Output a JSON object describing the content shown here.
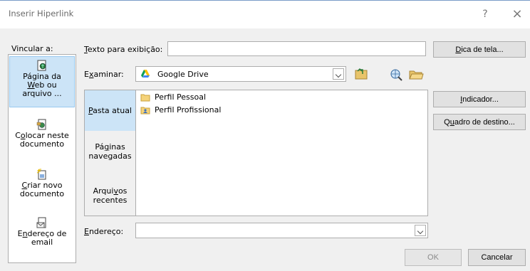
{
  "dialog": {
    "title": "Inserir Hiperlink",
    "help_label": "?",
    "close_label": "×"
  },
  "link_to": {
    "label": "Vincular a:",
    "items": [
      {
        "label": "Página da Web ou arquivo ...",
        "selected": true,
        "icon": "web-page-icon"
      },
      {
        "label": "Colocar neste documento",
        "selected": false,
        "icon": "place-in-document-icon"
      },
      {
        "label": "Criar novo documento",
        "selected": false,
        "icon": "new-document-icon"
      },
      {
        "label": "Endereço de email",
        "selected": false,
        "icon": "email-icon"
      }
    ]
  },
  "display_text": {
    "label": "Texto para exibição:",
    "value": ""
  },
  "look_in": {
    "label": "Examinar:",
    "value": "Google Drive",
    "icon": "google-drive-icon"
  },
  "browse_tabs": [
    {
      "label": "Pasta atual",
      "selected": true
    },
    {
      "label": "Páginas navegadas",
      "selected": false
    },
    {
      "label": "Arquivos recentes",
      "selected": false
    }
  ],
  "files": [
    {
      "name": "Perfil Pessoal",
      "icon": "folder-icon"
    },
    {
      "name": "Perfil Profissional",
      "icon": "shared-folder-icon"
    }
  ],
  "address": {
    "label": "Endereço:",
    "value": ""
  },
  "side_buttons": {
    "screentip": "Dica de tela...",
    "bookmark": "Indicador...",
    "target_frame": "Quadro de destino..."
  },
  "footer": {
    "ok": "OK",
    "cancel": "Cancelar"
  },
  "colors": {
    "selection": "#cce4f7",
    "dialog_bg": "#f0f0f0",
    "border": "#adadad"
  }
}
